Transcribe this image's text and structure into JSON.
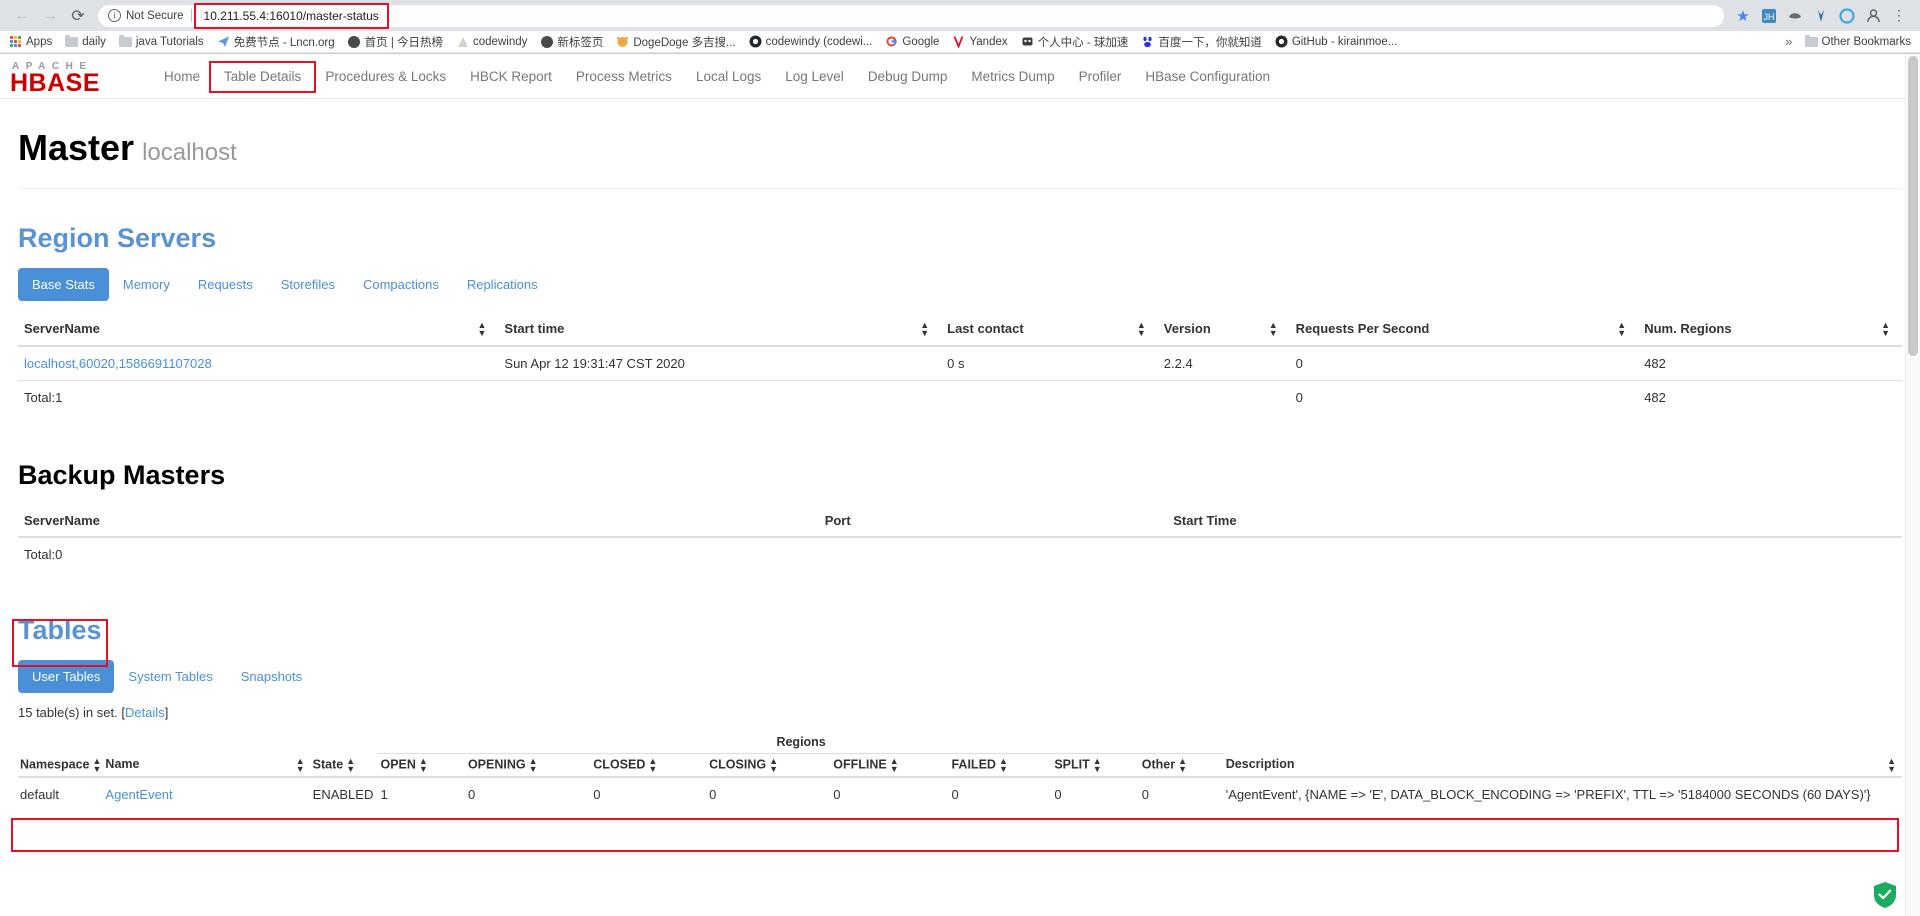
{
  "browser": {
    "back_icon": "←",
    "forward_icon": "→",
    "reload_icon": "⟳",
    "info_icon": "i",
    "security_label": "Not Secure",
    "url": "10.211.55.4:16010/master-status",
    "star_icon": "★",
    "profile_icon": "person-icon",
    "menu_icon": "⋮",
    "overflow_label": "»",
    "other_bookmarks_label": "Other Bookmarks",
    "bookmarks": [
      {
        "label": "Apps",
        "icon": "apps-grid-icon"
      },
      {
        "label": "daily",
        "icon": "folder-icon"
      },
      {
        "label": "java Tutorials",
        "icon": "folder-icon"
      },
      {
        "label": "免费节点 - Lncn.org",
        "icon": "paper-plane-icon"
      },
      {
        "label": "首页 | 今日热榜",
        "icon": "globe-icon"
      },
      {
        "label": "codewindy",
        "icon": "triangle-icon"
      },
      {
        "label": "新标签页",
        "icon": "globe-icon"
      },
      {
        "label": "DogeDoge 多吉搜...",
        "icon": "dog-icon"
      },
      {
        "label": "codewindy (codewi...",
        "icon": "github-icon"
      },
      {
        "label": "Google",
        "icon": "google-g-icon"
      },
      {
        "label": "Yandex",
        "icon": "yandex-v-icon"
      },
      {
        "label": "个人中心 - 球加速",
        "icon": "panda-icon"
      },
      {
        "label": "百度一下，你就知道",
        "icon": "baidu-icon"
      },
      {
        "label": "GitHub - kirainmoe...",
        "icon": "github-icon"
      }
    ]
  },
  "site": {
    "logo_top": "APACHE",
    "logo_main": "HBASE",
    "nav": [
      {
        "label": "Home",
        "highlighted": false
      },
      {
        "label": "Table Details",
        "highlighted": true
      },
      {
        "label": "Procedures & Locks",
        "highlighted": false
      },
      {
        "label": "HBCK Report",
        "highlighted": false
      },
      {
        "label": "Process Metrics",
        "highlighted": false
      },
      {
        "label": "Local Logs",
        "highlighted": false
      },
      {
        "label": "Log Level",
        "highlighted": false
      },
      {
        "label": "Debug Dump",
        "highlighted": false
      },
      {
        "label": "Metrics Dump",
        "highlighted": false
      },
      {
        "label": "Profiler",
        "highlighted": false
      },
      {
        "label": "HBase Configuration",
        "highlighted": false
      }
    ]
  },
  "master": {
    "title": "Master",
    "host": "localhost"
  },
  "region_servers": {
    "heading": "Region Servers",
    "tabs": [
      {
        "label": "Base Stats",
        "active": true
      },
      {
        "label": "Memory",
        "active": false
      },
      {
        "label": "Requests",
        "active": false
      },
      {
        "label": "Storefiles",
        "active": false
      },
      {
        "label": "Compactions",
        "active": false
      },
      {
        "label": "Replications",
        "active": false
      }
    ],
    "columns": [
      "ServerName",
      "Start time",
      "Last contact",
      "Version",
      "Requests Per Second",
      "Num. Regions"
    ],
    "rows": [
      {
        "server_name": "localhost,60020,1586691107028",
        "start_time": "Sun Apr 12 19:31:47 CST 2020",
        "last_contact": "0 s",
        "version": "2.2.4",
        "requests_per_second": "0",
        "num_regions": "482"
      }
    ],
    "total_label": "Total:1",
    "total_requests": "0",
    "total_regions": "482"
  },
  "backup_masters": {
    "heading": "Backup Masters",
    "columns": [
      "ServerName",
      "Port",
      "Start Time"
    ],
    "total_label": "Total:0"
  },
  "tables": {
    "heading": "Tables",
    "tabs": [
      {
        "label": "User Tables",
        "active": true
      },
      {
        "label": "System Tables",
        "active": false
      },
      {
        "label": "Snapshots",
        "active": false
      }
    ],
    "count_note": "15 table(s) in set. [",
    "details_link": "Details",
    "count_note_end": "]",
    "columns": {
      "namespace": "Namespace",
      "name": "Name",
      "state": "State",
      "regions_group": "Regions",
      "description": "Description",
      "region_sub": [
        "OPEN",
        "OPENING",
        "CLOSED",
        "CLOSING",
        "OFFLINE",
        "FAILED",
        "SPLIT",
        "Other"
      ]
    },
    "rows": [
      {
        "namespace": "default",
        "name": "AgentEvent",
        "state": "ENABLED",
        "open": "1",
        "opening": "0",
        "closed": "0",
        "closing": "0",
        "offline": "0",
        "failed": "0",
        "split": "0",
        "other": "0",
        "description": "'AgentEvent', {NAME => 'E', DATA_BLOCK_ENCODING => 'PREFIX', TTL => '5184000 SECONDS (60 DAYS)'}"
      }
    ]
  },
  "colors": {
    "accent_blue": "#4a90d9",
    "hbase_red": "#cc0000",
    "highlight_red": "#e81123",
    "shield_green": "#1aab5e"
  }
}
